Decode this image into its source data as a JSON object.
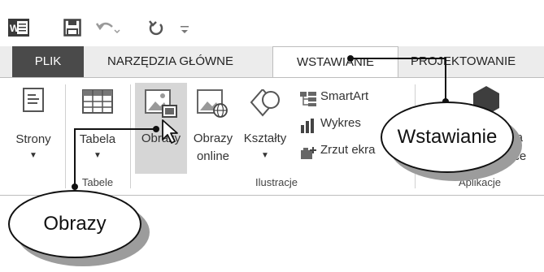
{
  "qat": {
    "icons": [
      "word-icon",
      "save-icon",
      "undo-icon",
      "redo-icon",
      "customize-qat-icon"
    ]
  },
  "tabs": [
    {
      "label": "PLIK"
    },
    {
      "label": "NARZĘDZIA GŁÓWNE"
    },
    {
      "label": "WSTAWIANIE"
    },
    {
      "label": "PROJEKTOWANIE"
    }
  ],
  "ribbon": {
    "pages": {
      "label": "Strony"
    },
    "table": {
      "label": "Tabela"
    },
    "tables_group": "Tabele",
    "pictures": {
      "label": "Obrazy"
    },
    "online_pictures": {
      "line1": "Obrazy",
      "line2": "online"
    },
    "shapes": {
      "label": "Kształty"
    },
    "smartart": "SmartArt",
    "chart": "Wykres",
    "screenshot": "Zrzut ekra",
    "illustrations_group": "Ilustracje",
    "apps": {
      "line1": "lla",
      "line2": "ice"
    },
    "apps_group": "Aplikacje"
  },
  "callouts": {
    "insert": "Wstawianie",
    "pictures": "Obrazy"
  }
}
